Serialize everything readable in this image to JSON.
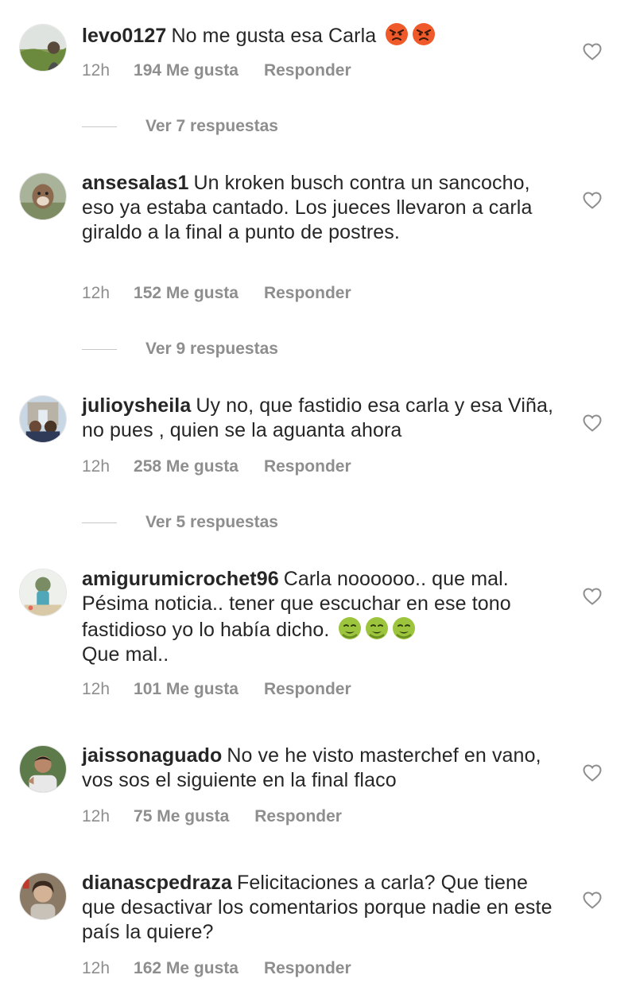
{
  "labels": {
    "likes_suffix": "Me gusta",
    "reply": "Responder"
  },
  "comments": [
    {
      "username": "levo0127",
      "text": "No me gusta esa Carla",
      "emoji": [
        "angry-face",
        "angry-face"
      ],
      "time": "12h",
      "likes": "194 Me gusta",
      "reply": "Responder",
      "view_replies": "Ver 7 respuestas"
    },
    {
      "username": "ansesalas1",
      "text": "Un kroken busch contra un sancocho, eso ya estaba cantado. Los jueces llevaron a carla giraldo a la final a punto de postres.",
      "time": "12h",
      "likes": "152 Me gusta",
      "reply": "Responder",
      "view_replies": "Ver 9 respuestas"
    },
    {
      "username": "julioysheila",
      "text": "Uy no, que fastidio esa carla y esa Viña, no pues , quien se la aguanta ahora",
      "time": "12h",
      "likes": "258 Me gusta",
      "reply": "Responder",
      "view_replies": "Ver 5 respuestas"
    },
    {
      "username": "amigurumicrochet96",
      "text": "Carla noooooo.. que mal. Pésima noticia.. tener que escuchar en ese tono fastidioso yo lo había dicho.",
      "text_after": "Que mal..",
      "emoji": [
        "nauseated-face",
        "nauseated-face",
        "nauseated-face"
      ],
      "time": "12h",
      "likes": "101 Me gusta",
      "reply": "Responder"
    },
    {
      "username": "jaissonaguado",
      "text": "No ve he visto masterchef en vano, vos sos el siguiente en la final flaco",
      "time": "12h",
      "likes": "75 Me gusta",
      "reply": "Responder"
    },
    {
      "username": "dianascpedraza",
      "text": "Felicitaciones a carla? Que tiene que desactivar los comentarios porque nadie en este país la quiere?",
      "time": "12h",
      "likes": "162 Me gusta",
      "reply": "Responder"
    }
  ],
  "icons": {
    "like": "heart-outline-icon",
    "angry": "angry-face-emoji",
    "nauseated": "nauseated-face-emoji"
  },
  "colors": {
    "text": "#262626",
    "secondary": "#8e8e8e",
    "divider": "#c7c7c7"
  }
}
